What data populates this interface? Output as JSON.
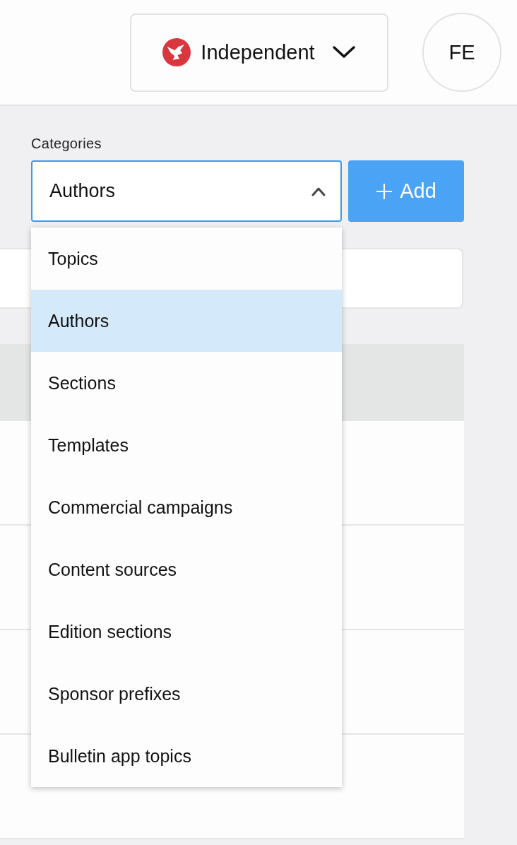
{
  "header": {
    "publication_switcher": {
      "label": "Independent"
    },
    "avatar": {
      "initials": "FE"
    }
  },
  "categories": {
    "label": "Categories",
    "value": "Authors",
    "expanded": true,
    "options": [
      {
        "label": "Topics",
        "selected": false
      },
      {
        "label": "Authors",
        "selected": true
      },
      {
        "label": "Sections",
        "selected": false
      },
      {
        "label": "Templates",
        "selected": false
      },
      {
        "label": "Commercial campaigns",
        "selected": false
      },
      {
        "label": "Content sources",
        "selected": false
      },
      {
        "label": "Edition sections",
        "selected": false
      },
      {
        "label": "Sponsor prefixes",
        "selected": false
      },
      {
        "label": "Bulletin app topics",
        "selected": false
      }
    ]
  },
  "add_button": {
    "label": "Add"
  }
}
